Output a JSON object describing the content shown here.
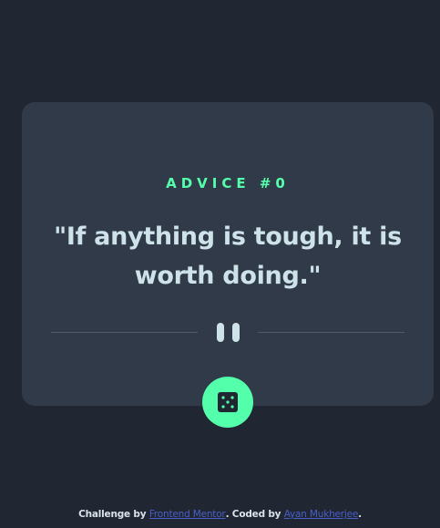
{
  "card": {
    "advice_label": "ADVICE #0",
    "quote": "\"If anything is tough, it is worth doing.\""
  },
  "dice_button": {
    "icon": "dice-icon"
  },
  "attribution": {
    "prefix": "Challenge by ",
    "challenge_link": "Frontend Mentor",
    "middle": ". Coded by ",
    "author_link": "Ayan Mukherjee",
    "suffix": "."
  },
  "colors": {
    "background": "#202733",
    "card": "#313a48",
    "accent": "#53ffaa",
    "text": "#cee3e9",
    "link": "#4a5ec7"
  }
}
